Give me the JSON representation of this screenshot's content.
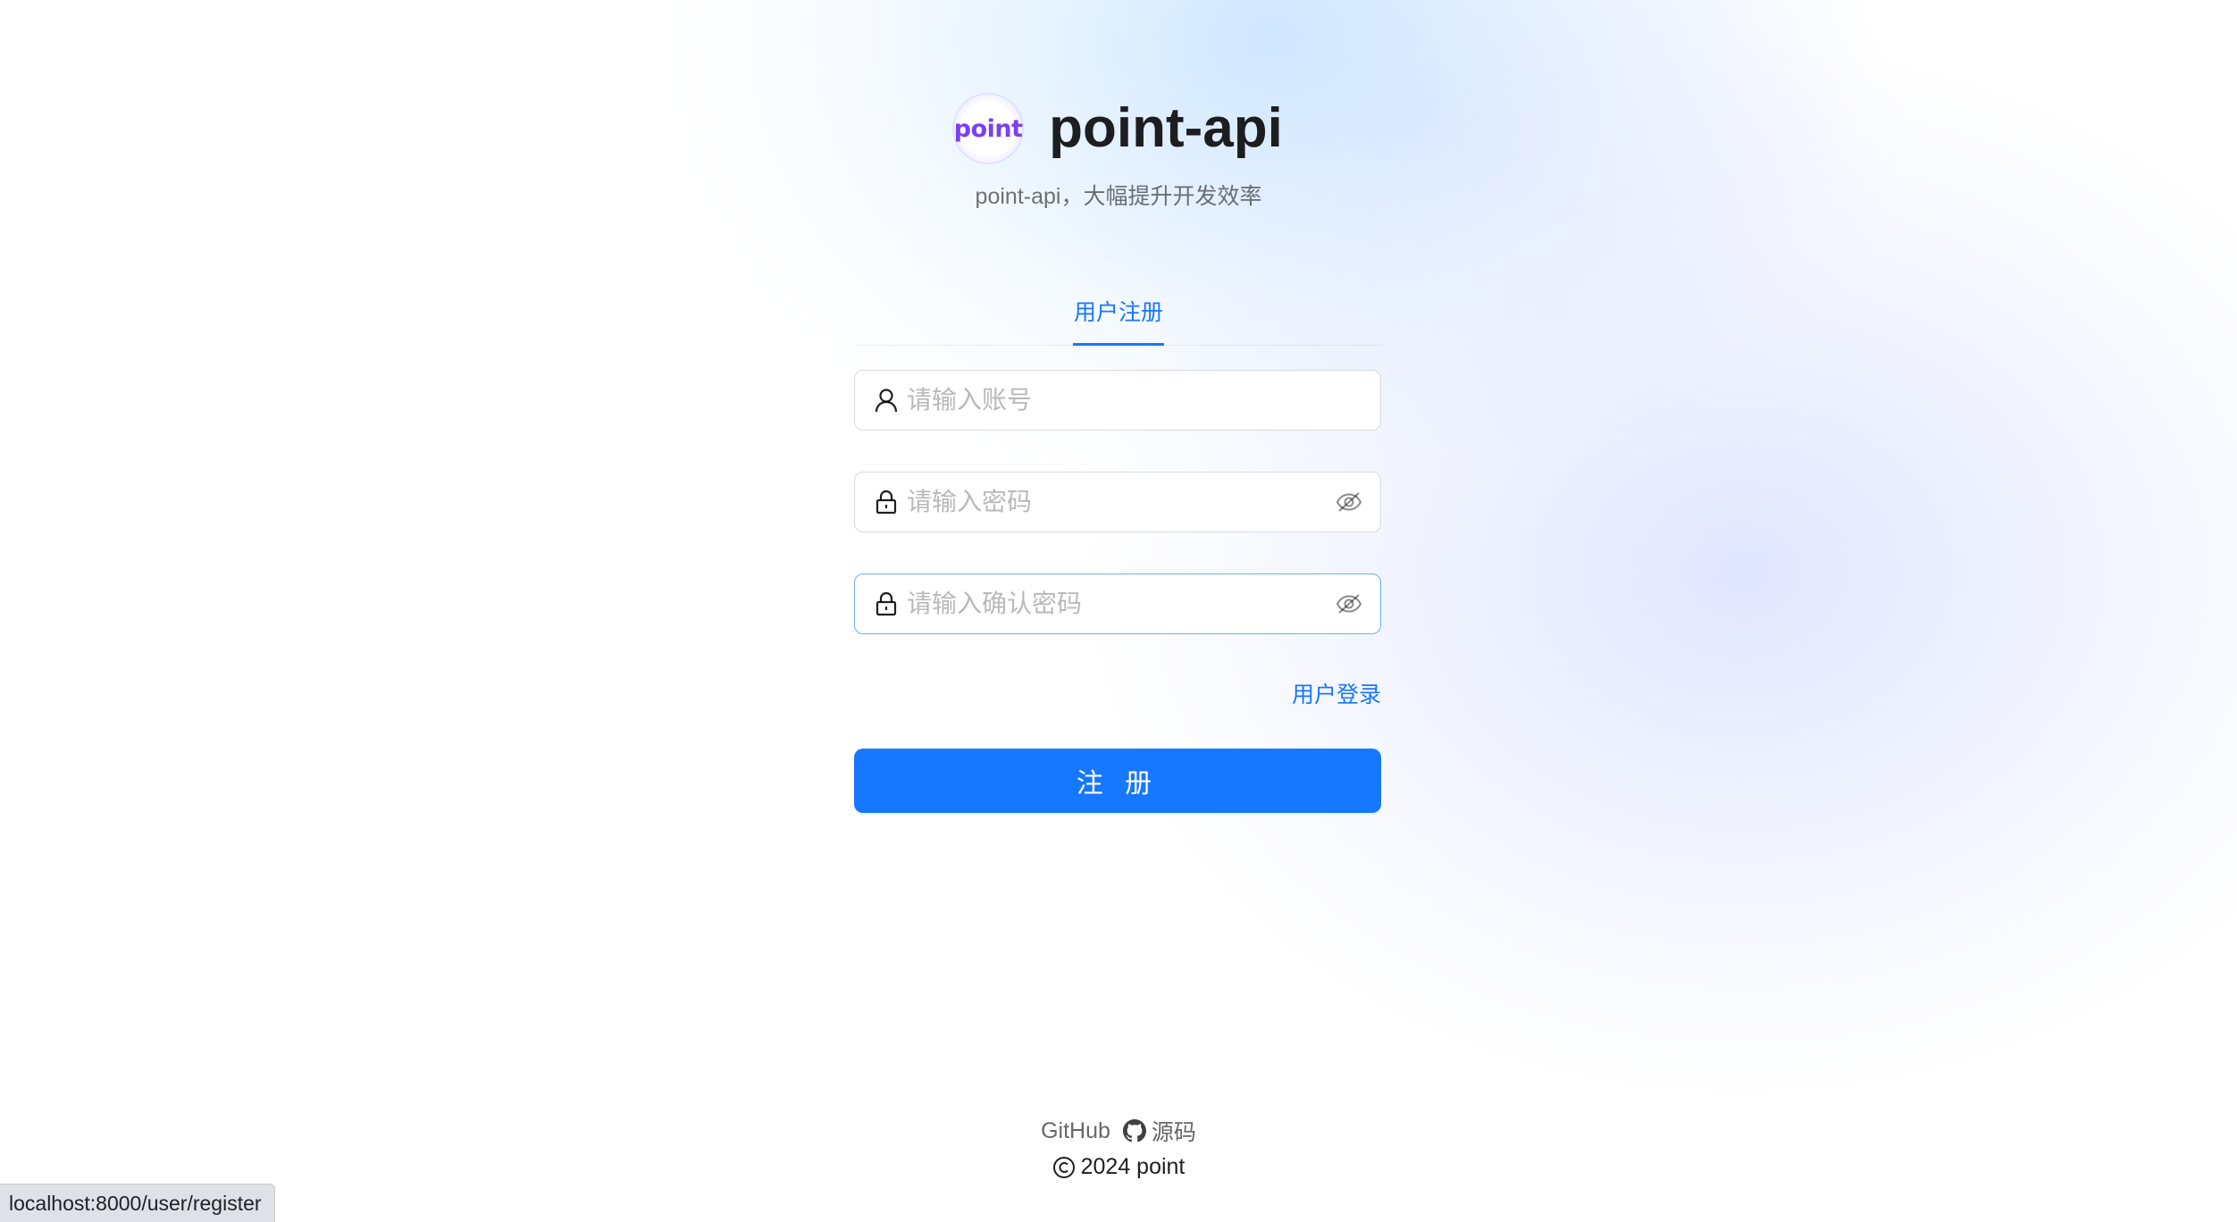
{
  "brand": {
    "logo_text": "point",
    "title": "point-api",
    "subtitle": "point-api，大幅提升开发效率"
  },
  "tabs": [
    {
      "label": "用户注册",
      "active": true
    }
  ],
  "form": {
    "account": {
      "placeholder": "请输入账号",
      "icon": "user-icon"
    },
    "password": {
      "placeholder": "请输入密码",
      "icon": "lock-icon",
      "toggle_icon": "eye-invisible-icon"
    },
    "confirm_password": {
      "placeholder": "请输入确认密码",
      "icon": "lock-icon",
      "toggle_icon": "eye-invisible-icon"
    },
    "login_link": "用户登录",
    "submit_label": "注 册"
  },
  "footer": {
    "github_label": "GitHub",
    "source_label": "源码",
    "copyright": "2024 point"
  },
  "status_bar": {
    "url": "localhost:8000/user/register"
  },
  "colors": {
    "primary": "#1677ff",
    "logo": "#7b3ff2"
  }
}
